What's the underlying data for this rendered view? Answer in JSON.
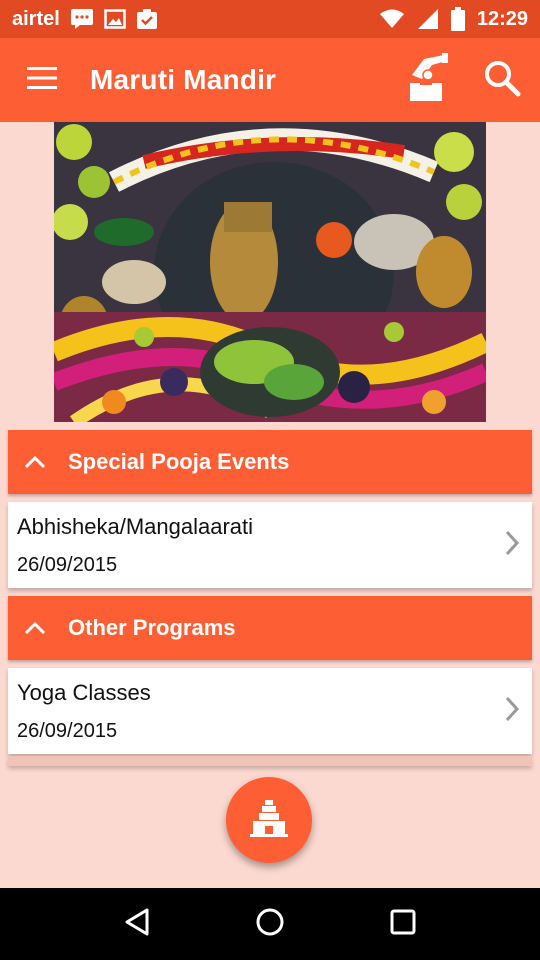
{
  "status_bar": {
    "carrier": "airtel",
    "time": "12:29",
    "left_icons": [
      "sms-icon",
      "image-icon",
      "clipboard-check-icon"
    ],
    "right_icons": [
      "wifi-icon",
      "signal-icon",
      "battery-icon"
    ]
  },
  "app_bar": {
    "title": "Maruti Mandir",
    "menu_icon": "hamburger-menu-icon",
    "actions": [
      "donation-box-icon",
      "search-icon"
    ]
  },
  "hero": {
    "icon": "temple-deity-photo"
  },
  "sections": [
    {
      "title": "Special Pooja Events",
      "expanded": true,
      "items": [
        {
          "name": "Abhisheka/Mangalaarati",
          "date": "26/09/2015"
        }
      ]
    },
    {
      "title": "Other Programs",
      "expanded": true,
      "items": [
        {
          "name": "Yoga Classes",
          "date": "26/09/2015"
        }
      ]
    }
  ],
  "fab": {
    "icon": "temple-gopuram-icon"
  },
  "nav_bar": {
    "icons": [
      "back-icon",
      "home-icon",
      "recents-icon"
    ]
  },
  "colors": {
    "status_bar": "#e14a22",
    "primary": "#fe5e33",
    "background": "#fcd9d0",
    "card": "#ffffff",
    "nav": "#000000"
  }
}
